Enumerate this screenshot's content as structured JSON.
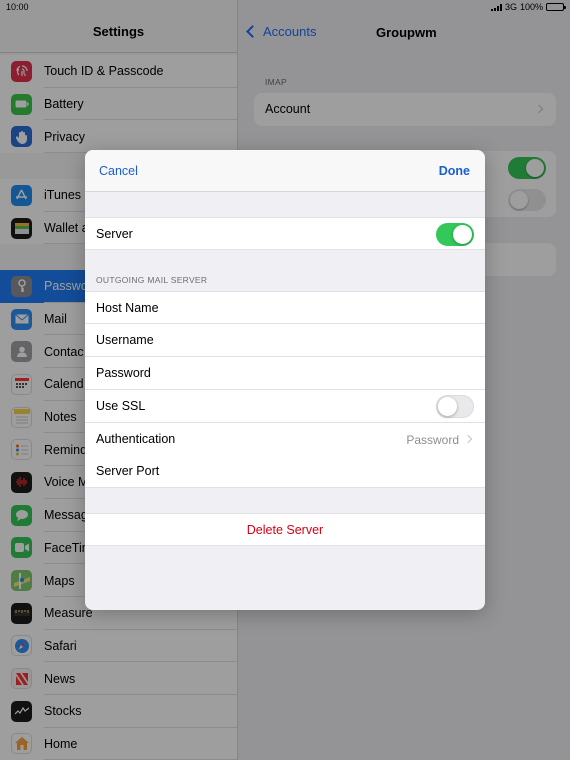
{
  "status": {
    "time": "10:00",
    "network": "3G",
    "battery": "100%"
  },
  "sidebar": {
    "title": "Settings",
    "groups": [
      {
        "items": [
          {
            "label": "Touch ID & Passcode",
            "icon": "fingerprint-icon",
            "color": "#e0334d"
          },
          {
            "label": "Battery",
            "icon": "battery-icon",
            "color": "#3cc64a"
          },
          {
            "label": "Privacy",
            "icon": "hand-icon",
            "color": "#2d6fd6"
          }
        ]
      },
      {
        "items": [
          {
            "label": "iTunes",
            "icon": "app-store-icon",
            "color": "#1f8ff0"
          },
          {
            "label": "Wallet a",
            "icon": "wallet-icon",
            "color": "#1c1c1e"
          }
        ]
      },
      {
        "items": [
          {
            "label": "Passwo",
            "icon": "key-icon",
            "color": "#8e8e93",
            "selected": true
          },
          {
            "label": "Mail",
            "icon": "mail-icon",
            "color": "#2f8ef5"
          },
          {
            "label": "Contac",
            "icon": "contacts-icon",
            "color": "#a2a2a7"
          },
          {
            "label": "Calend",
            "icon": "calendar-icon",
            "color": "#ffffff"
          },
          {
            "label": "Notes",
            "icon": "notes-icon",
            "color": "#f9d34a"
          },
          {
            "label": "Remind",
            "icon": "reminders-icon",
            "color": "#ffffff"
          },
          {
            "label": "Voice M",
            "icon": "voice-memos-icon",
            "color": "#1c1c1e"
          },
          {
            "label": "Messag",
            "icon": "messages-icon",
            "color": "#35c759"
          },
          {
            "label": "FaceTim",
            "icon": "facetime-icon",
            "color": "#35c759"
          },
          {
            "label": "Maps",
            "icon": "maps-icon",
            "color": "#7fc96e"
          },
          {
            "label": "Measure",
            "icon": "measure-icon",
            "color": "#1c1c1e"
          },
          {
            "label": "Safari",
            "icon": "safari-icon",
            "color": "#2f8ef5"
          },
          {
            "label": "News",
            "icon": "news-icon",
            "color": "#f6f6f6"
          },
          {
            "label": "Stocks",
            "icon": "stocks-icon",
            "color": "#1c1c1e"
          },
          {
            "label": "Home",
            "icon": "home-icon",
            "color": "#f7a23b"
          }
        ]
      }
    ]
  },
  "detail": {
    "back_label": "Accounts",
    "title": "Groupwm",
    "section": "IMAP",
    "account_label": "Account"
  },
  "modal": {
    "cancel_label": "Cancel",
    "done_label": "Done",
    "server_label": "Server",
    "server_on": true,
    "section_header": "OUTGOING MAIL SERVER",
    "fields": {
      "host_name": "Host Name",
      "username": "Username",
      "password": "Password",
      "use_ssl": "Use SSL",
      "authentication": "Authentication",
      "authentication_value": "Password",
      "server_port": "Server Port"
    },
    "use_ssl_on": false,
    "delete_label": "Delete Server"
  },
  "colors": {
    "accent": "#1a5fd0",
    "toggle_on": "#34c759",
    "destructive": "#d70015",
    "selected": "#1f7bf5"
  }
}
